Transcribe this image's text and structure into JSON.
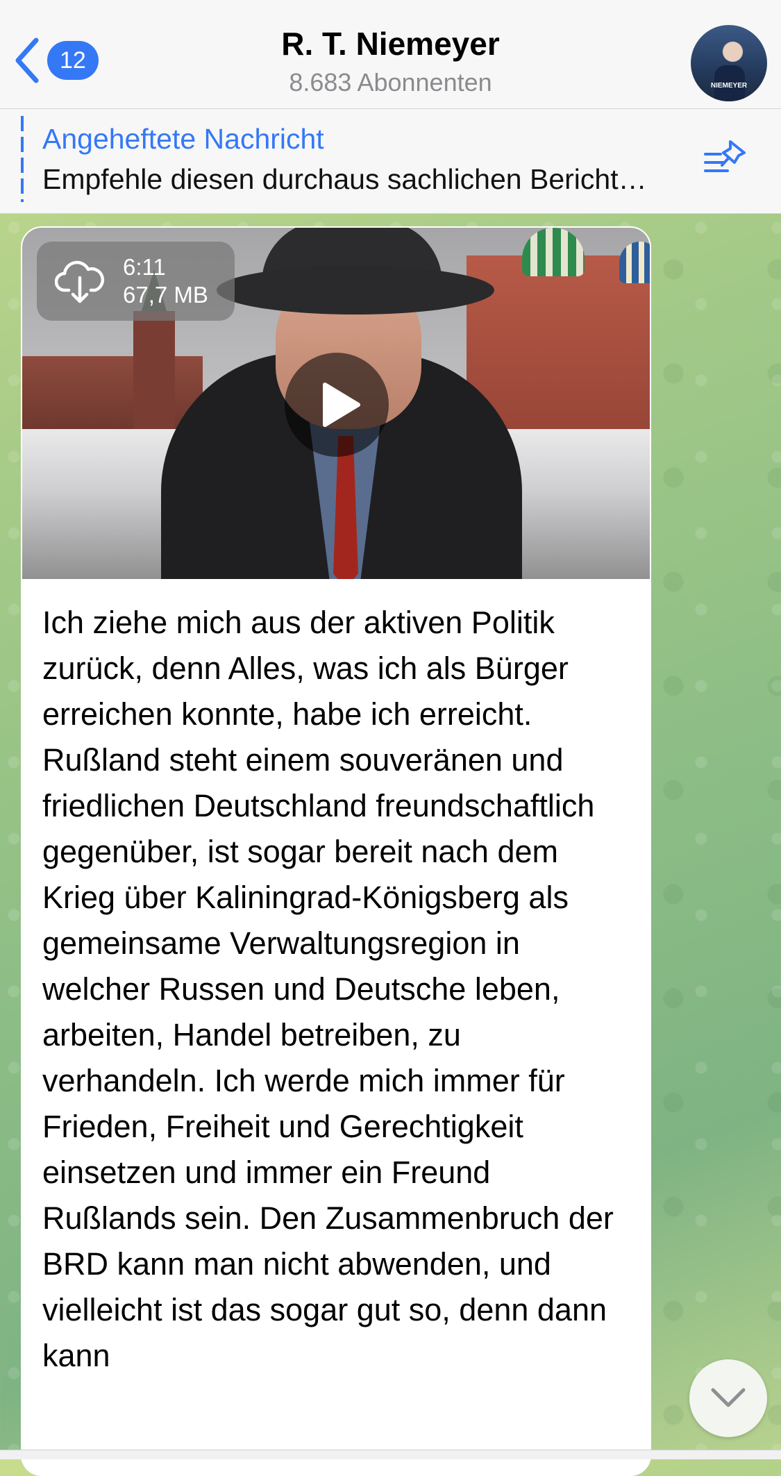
{
  "header": {
    "back_count": "12",
    "title": "R. T. Niemeyer",
    "subtitle": "8.683 Abonnenten",
    "avatar_caption": "NIEMEYER"
  },
  "pinned": {
    "title": "Angeheftete Nachricht",
    "text": "Empfehle diesen durchaus sachlichen Bericht…"
  },
  "message": {
    "video": {
      "duration": "6:11",
      "size": "67,7 MB"
    },
    "text": "Ich ziehe mich aus der aktiven Politik zurück, denn Alles, was ich als Bürger erreichen konnte, habe ich erreicht. Rußland steht einem souveränen und friedlichen Deutschland freundschaftlich gegenüber, ist sogar bereit nach dem Krieg über Kaliningrad-Königsberg als gemeinsame Verwaltungsregion in welcher Russen und Deutsche leben, arbeiten, Handel betreiben, zu verhandeln. Ich werde mich immer für Frieden, Freiheit und Gerechtigkeit einsetzen und immer ein Freund Rußlands sein. Den Zusammenbruch der BRD kann man nicht abwenden, und vielleicht ist das sogar gut so, denn dann kann"
  },
  "colors": {
    "accent": "#3478f6",
    "header_bg": "#f7f7f7",
    "bubble_bg": "#ffffff"
  },
  "icons": {
    "back": "chevron-left-icon",
    "pin": "pinned-list-icon",
    "download": "cloud-download-icon",
    "play": "play-icon",
    "scroll": "chevron-down-icon"
  }
}
